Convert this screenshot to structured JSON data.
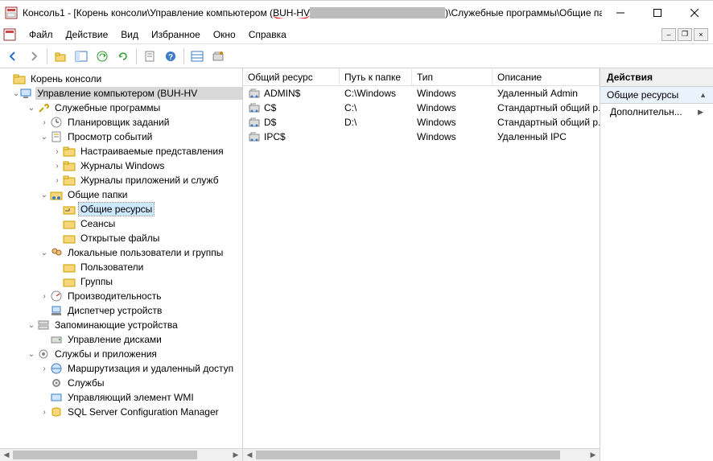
{
  "titlebar": {
    "title_prefix": "Консоль1 - [Корень консоли\\Управление компьютером (",
    "server_visible": "BUH-HV",
    "title_suffix": ")\\Служебные программы\\Общие пап..."
  },
  "menu": {
    "file": "Файл",
    "action": "Действие",
    "view": "Вид",
    "favorites": "Избранное",
    "window": "Окно",
    "help": "Справка"
  },
  "tree": {
    "root": "Корень консоли",
    "compmgmt": "Управление компьютером (BUH-HV",
    "systools": "Служебные программы",
    "scheduler": "Планировщик заданий",
    "eventviewer": "Просмотр событий",
    "customviews": "Настраиваемые представления",
    "winlogs": "Журналы Windows",
    "appsvclogs": "Журналы приложений и служб",
    "sharedfolders": "Общие папки",
    "shares": "Общие ресурсы",
    "sessions": "Сеансы",
    "openfiles": "Открытые файлы",
    "localusers": "Локальные пользователи и группы",
    "users": "Пользователи",
    "groups": "Группы",
    "perf": "Производительность",
    "devmgr": "Диспетчер устройств",
    "storage": "Запоминающие устройства",
    "diskmgmt": "Управление дисками",
    "services_apps": "Службы и приложения",
    "rras": "Маршрутизация и удаленный доступ",
    "services": "Службы",
    "wmi": "Управляющий элемент WMI",
    "sqlmgr": "SQL Server Configuration Manager"
  },
  "list": {
    "columns": {
      "share": "Общий ресурс",
      "path": "Путь к папке",
      "type": "Тип",
      "desc": "Описание"
    },
    "rows": [
      {
        "share": "ADMIN$",
        "path": "C:\\Windows",
        "type": "Windows",
        "desc": "Удаленный Admin"
      },
      {
        "share": "C$",
        "path": "C:\\",
        "type": "Windows",
        "desc": "Стандартный общий р..."
      },
      {
        "share": "D$",
        "path": "D:\\",
        "type": "Windows",
        "desc": "Стандартный общий р..."
      },
      {
        "share": "IPC$",
        "path": "",
        "type": "Windows",
        "desc": "Удаленный IPC"
      }
    ]
  },
  "actions": {
    "header": "Действия",
    "section": "Общие ресурсы",
    "more": "Дополнительн..."
  }
}
